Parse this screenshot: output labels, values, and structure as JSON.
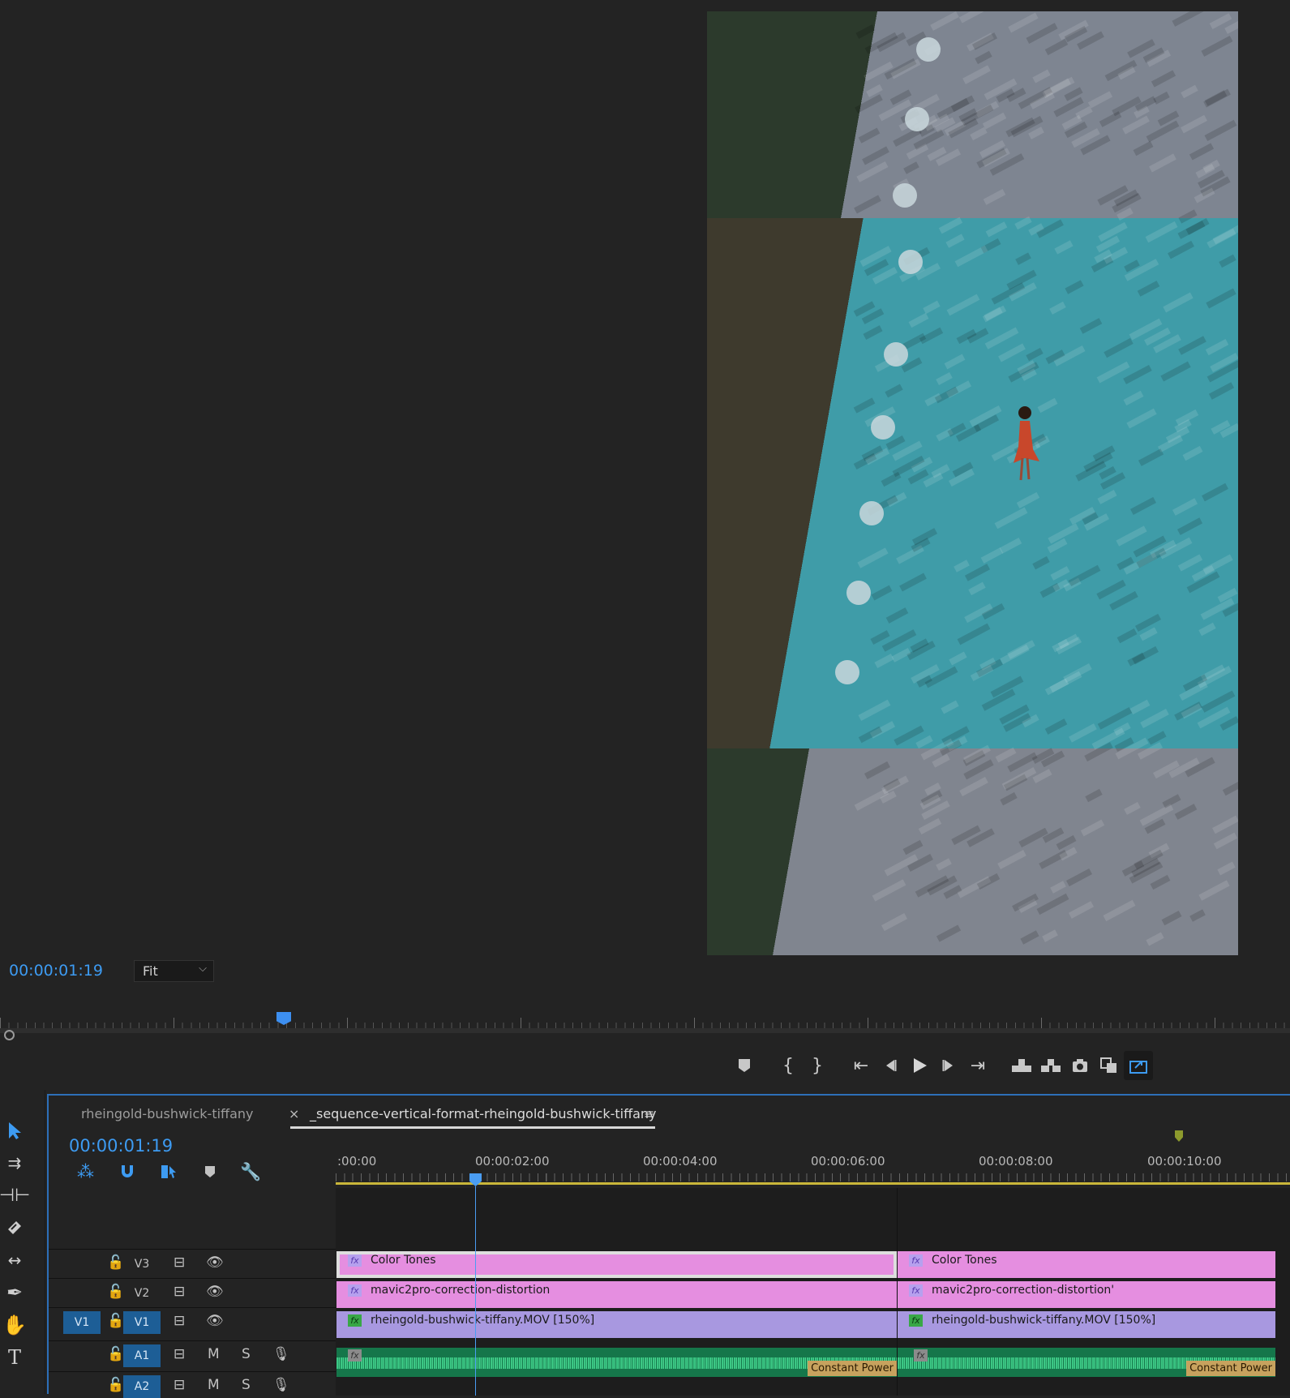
{
  "monitor": {
    "timecode": "00:00:01:19",
    "zoom_select": "Fit"
  },
  "transport": {
    "buttons": [
      "add-marker",
      "mark-in",
      "mark-out",
      "go-to-in",
      "step-back",
      "play",
      "step-forward",
      "go-to-out",
      "lift",
      "extract",
      "export-frame",
      "comparison-view",
      "export-button"
    ]
  },
  "tools": [
    "selection",
    "track-select",
    "ripple-edit",
    "razor",
    "slip",
    "pen",
    "hand",
    "type"
  ],
  "timeline": {
    "tabs": [
      {
        "label": "rheingold-bushwick-tiffany",
        "active": false
      },
      {
        "label": "_sequence-vertical-format-rheingold-bushwick-tiffany",
        "active": true
      }
    ],
    "close_glyph": "×",
    "menu_glyph": "≡",
    "timecode": "00:00:01:19",
    "ruler_labels": [
      ":00:00",
      "00:00:02:00",
      "00:00:04:00",
      "00:00:06:00",
      "00:00:08:00",
      "00:00:10:00"
    ],
    "tracks": {
      "v3": "V3",
      "v2": "V2",
      "v1": "V1",
      "v1_source": "V1",
      "a1": "A1",
      "a2": "A2",
      "mute": "M",
      "solo": "S"
    },
    "clips": {
      "v3_a": "Color Tones",
      "v3_b": "Color Tones",
      "v2_a": "mavic2pro-correction-distortion",
      "v2_b": "mavic2pro-correction-distortion'",
      "v1_a": "rheingold-bushwick-tiffany.MOV [150%]",
      "v1_b": "rheingold-bushwick-tiffany.MOV [150%]",
      "fx_glyph": "fx",
      "transition_a": "Constant Power",
      "transition_b": "Constant Power"
    }
  },
  "colors": {
    "accent": "#3d9bf2",
    "adjustment_clip": "#e58ee0",
    "video_clip": "#a898e0",
    "audio_clip": "#15764a"
  }
}
